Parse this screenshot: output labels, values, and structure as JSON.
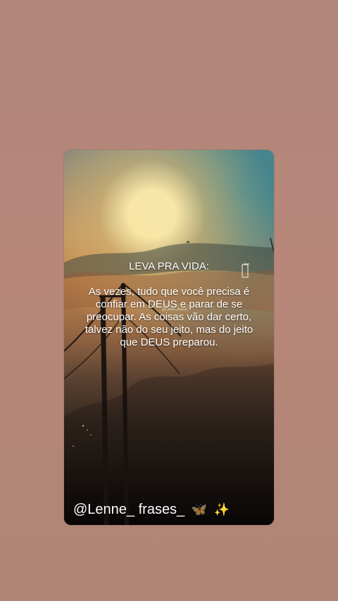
{
  "content": {
    "title": "LEVA PRA VIDA:",
    "body": "As vezes, tudo que você precisa é confiar em DEUS e parar de se preocupar. As coisas vão dar certo, talvez não do seu jeito, mas do jeito que DEUS preparou.",
    "watermark": "@Lenne_frases_",
    "handle": "@Lenne_ frases_",
    "emoji_butterfly": "🦋",
    "emoji_sparkles": "✨"
  },
  "colors": {
    "page_background": "#b58575",
    "text": "#ffffff",
    "card_overlay": "#17100f"
  },
  "icons": {
    "butterfly": "butterfly-icon",
    "sparkles": "sparkles-icon"
  }
}
